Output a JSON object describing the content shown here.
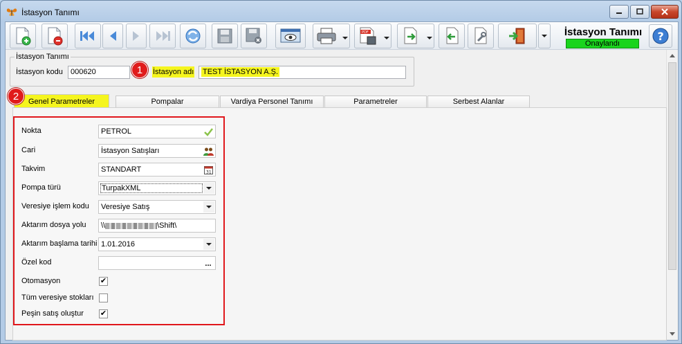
{
  "window": {
    "title": "İstasyon Tanımı"
  },
  "status": {
    "title": "İstasyon Tanımı",
    "badge": "Onaylandı",
    "badge_color": "#19d41d"
  },
  "toolbar": {
    "buttons": [
      {
        "name": "new-record-icon"
      },
      {
        "name": "delete-record-icon"
      },
      {
        "name": "first-record-icon"
      },
      {
        "name": "previous-record-icon"
      },
      {
        "name": "next-record-icon"
      },
      {
        "name": "last-record-icon"
      },
      {
        "name": "refresh-icon"
      },
      {
        "name": "save-icon"
      },
      {
        "name": "save-close-icon"
      },
      {
        "name": "preview-icon"
      },
      {
        "name": "print-icon"
      },
      {
        "name": "pdf-export-icon"
      },
      {
        "name": "import-icon"
      },
      {
        "name": "export-icon"
      },
      {
        "name": "tools-icon"
      },
      {
        "name": "exit-icon"
      },
      {
        "name": "help-icon"
      }
    ]
  },
  "group": {
    "title": "İstasyon Tanımı",
    "code_label": "İstasyon kodu",
    "code_value": "000620",
    "name_label": "İstasyon adı",
    "name_value": "TEST İSTASYON A.Ş."
  },
  "markers": {
    "first": "1",
    "second": "2"
  },
  "tabs": [
    {
      "label": "Genel Parametreler",
      "active": true
    },
    {
      "label": "Pompalar"
    },
    {
      "label": "Vardiya Personel Tanımı"
    },
    {
      "label": "Parametreler"
    },
    {
      "label": "Serbest Alanlar"
    }
  ],
  "form": {
    "nokta_label": "Nokta",
    "nokta_value": "PETROL",
    "cari_label": "Cari",
    "cari_value": "İstasyon Satışları",
    "takvim_label": "Takvim",
    "takvim_value": "STANDART",
    "pompa_label": "Pompa türü",
    "pompa_value": "TurpakXML",
    "veresiye_label": "Veresiye işlem kodu",
    "veresiye_value": "Veresiye Satış",
    "aktarim_yol_label": "Aktarım dosya yolu",
    "aktarim_yol_prefix": "\\\\",
    "aktarim_yol_suffix": "\\Shift\\",
    "aktarim_tarih_label": "Aktarım başlama tarihi",
    "aktarim_tarih_value": "1.01.2016",
    "ozel_kod_label": "Özel kod",
    "ozel_kod_value": "",
    "ozel_kod_btn": "...",
    "otomasyon_label": "Otomasyon",
    "otomasyon_checked": "✔",
    "tum_veresiye_label": "Tüm veresiye stokları",
    "tum_veresiye_checked": "",
    "pesin_label": "Peşin satış oluştur",
    "pesin_checked": "✔"
  },
  "colors": {
    "highlight": "#f5f51e",
    "marker": "#e01b1b",
    "frame": "#e0161b"
  }
}
